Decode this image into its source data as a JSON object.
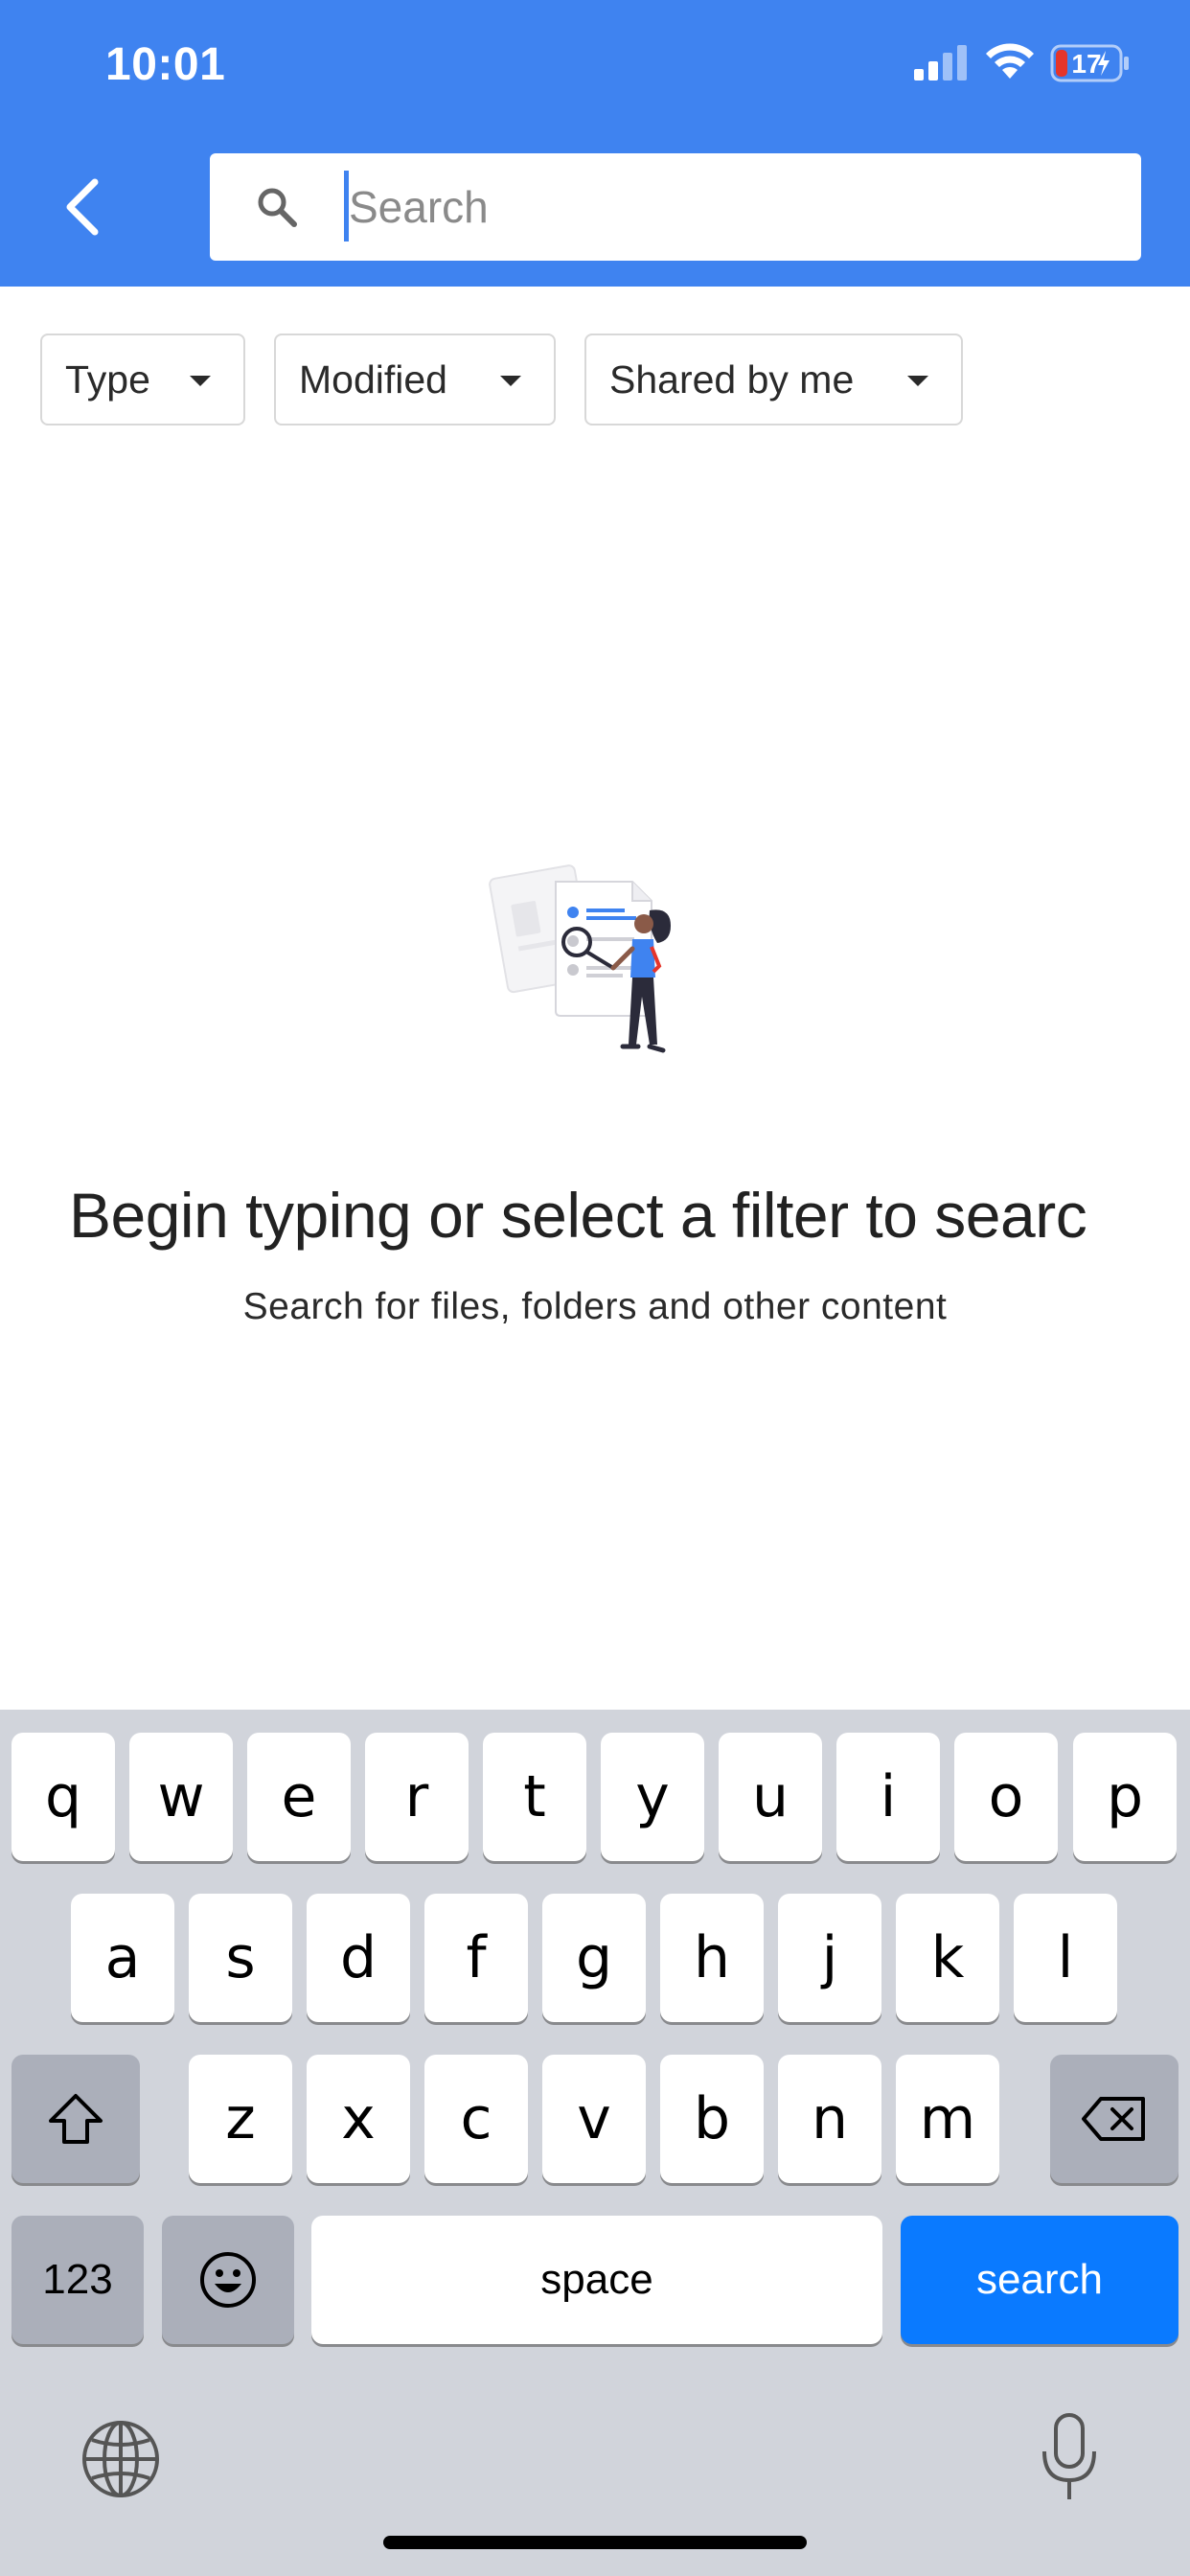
{
  "status_bar": {
    "time": "10:01",
    "battery_level": "17",
    "icons": [
      "cellular-signal-icon",
      "wifi-icon",
      "battery-charging-icon"
    ]
  },
  "header": {
    "background_color": "#3F83F0",
    "back_icon": "chevron-left-icon",
    "search": {
      "icon": "search-icon",
      "placeholder": "Search",
      "value": ""
    }
  },
  "filters": [
    {
      "label": "Type",
      "icon": "dropdown-arrow-icon"
    },
    {
      "label": "Modified",
      "icon": "dropdown-arrow-icon"
    },
    {
      "label": "Shared by me",
      "icon": "dropdown-arrow-icon"
    }
  ],
  "empty_state": {
    "illustration": "person-searching-documents-illustration",
    "title": "Begin typing or select a filter to searc",
    "subtitle": "Search for files, folders and other content"
  },
  "keyboard": {
    "row1": [
      "q",
      "w",
      "e",
      "r",
      "t",
      "y",
      "u",
      "i",
      "o",
      "p"
    ],
    "row2": [
      "a",
      "s",
      "d",
      "f",
      "g",
      "h",
      "j",
      "k",
      "l"
    ],
    "row3": [
      "z",
      "x",
      "c",
      "v",
      "b",
      "n",
      "m"
    ],
    "shift_icon": "shift-icon",
    "delete_icon": "backspace-icon",
    "numbers_label": "123",
    "emoji_icon": "emoji-icon",
    "space_label": "space",
    "return_label": "search",
    "globe_icon": "globe-icon",
    "mic_icon": "microphone-icon",
    "return_color": "#0A7AFF"
  }
}
